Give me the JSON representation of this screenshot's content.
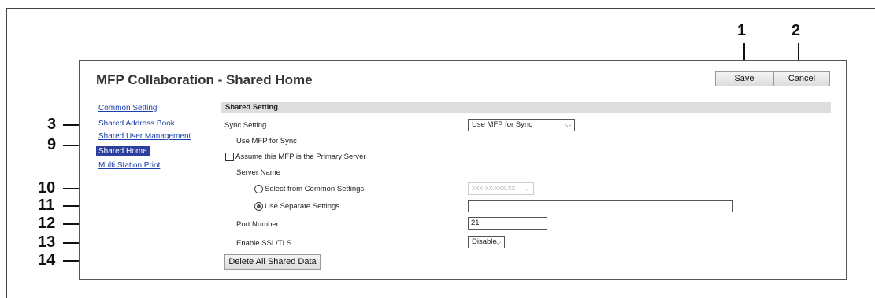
{
  "page_title": "MFP Collaboration - Shared Home",
  "buttons": {
    "save": "Save",
    "cancel": "Cancel",
    "delete_all": "Delete All Shared Data"
  },
  "nav": [
    {
      "label": "Common Setting",
      "active": false
    },
    {
      "label": "Shared Address Book",
      "active": false
    },
    {
      "label": "Shared User Management",
      "active": false
    },
    {
      "label": "Shared Home",
      "active": true
    },
    {
      "label": "Multi Station Print",
      "active": false
    }
  ],
  "section_title": "Shared Setting",
  "fields": {
    "sync_setting": {
      "label": "Sync Setting",
      "value": "Use MFP for Sync"
    },
    "use_mfp_for_sync": {
      "label": "Use MFP for Sync"
    },
    "primary_server": {
      "label": "Assume this MFP is the Primary Server",
      "checked": false
    },
    "server_name": {
      "label": "Server Name"
    },
    "select_common": {
      "label": "Select from Common Settings",
      "selected": false,
      "value": "xxx.xx.xxx.xx"
    },
    "use_separate": {
      "label": "Use Separate Settings",
      "selected": true,
      "value": ""
    },
    "port_number": {
      "label": "Port Number",
      "value": "21"
    },
    "ssl_tls": {
      "label": "Enable SSL/TLS",
      "value": "Disable"
    }
  },
  "callouts": [
    "1",
    "2",
    "3",
    "9",
    "10",
    "11",
    "12",
    "13",
    "14"
  ]
}
